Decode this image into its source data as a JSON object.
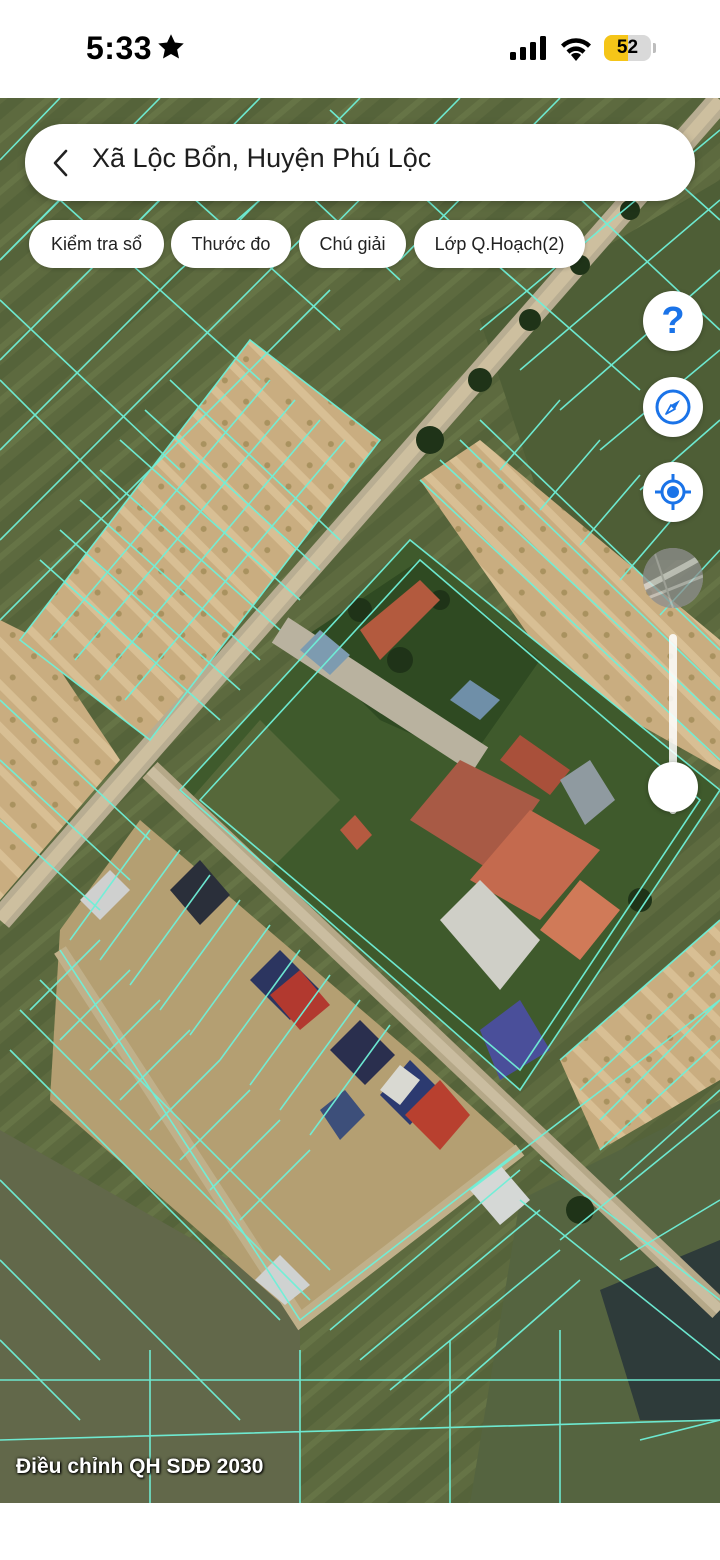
{
  "status_bar": {
    "time": "5:33",
    "battery_level": 52,
    "battery_text": "52",
    "battery_color": "#f5c518"
  },
  "search": {
    "title": "Xã Lộc Bổn, Huyện Phú Lộc"
  },
  "chips": [
    {
      "label": "Kiểm tra sổ"
    },
    {
      "label": "Thước đo"
    },
    {
      "label": "Chú giải"
    },
    {
      "label": "Lớp Q.Hoạch(2)"
    }
  ],
  "controls": {
    "help_glyph": "?",
    "accent_color": "#1a73e8",
    "zoom_level": 0.15
  },
  "map": {
    "type": "satellite",
    "parcel_line_color": "#6ff0d8",
    "plan_label": "Điều chỉnh QH SDĐ 2030"
  }
}
